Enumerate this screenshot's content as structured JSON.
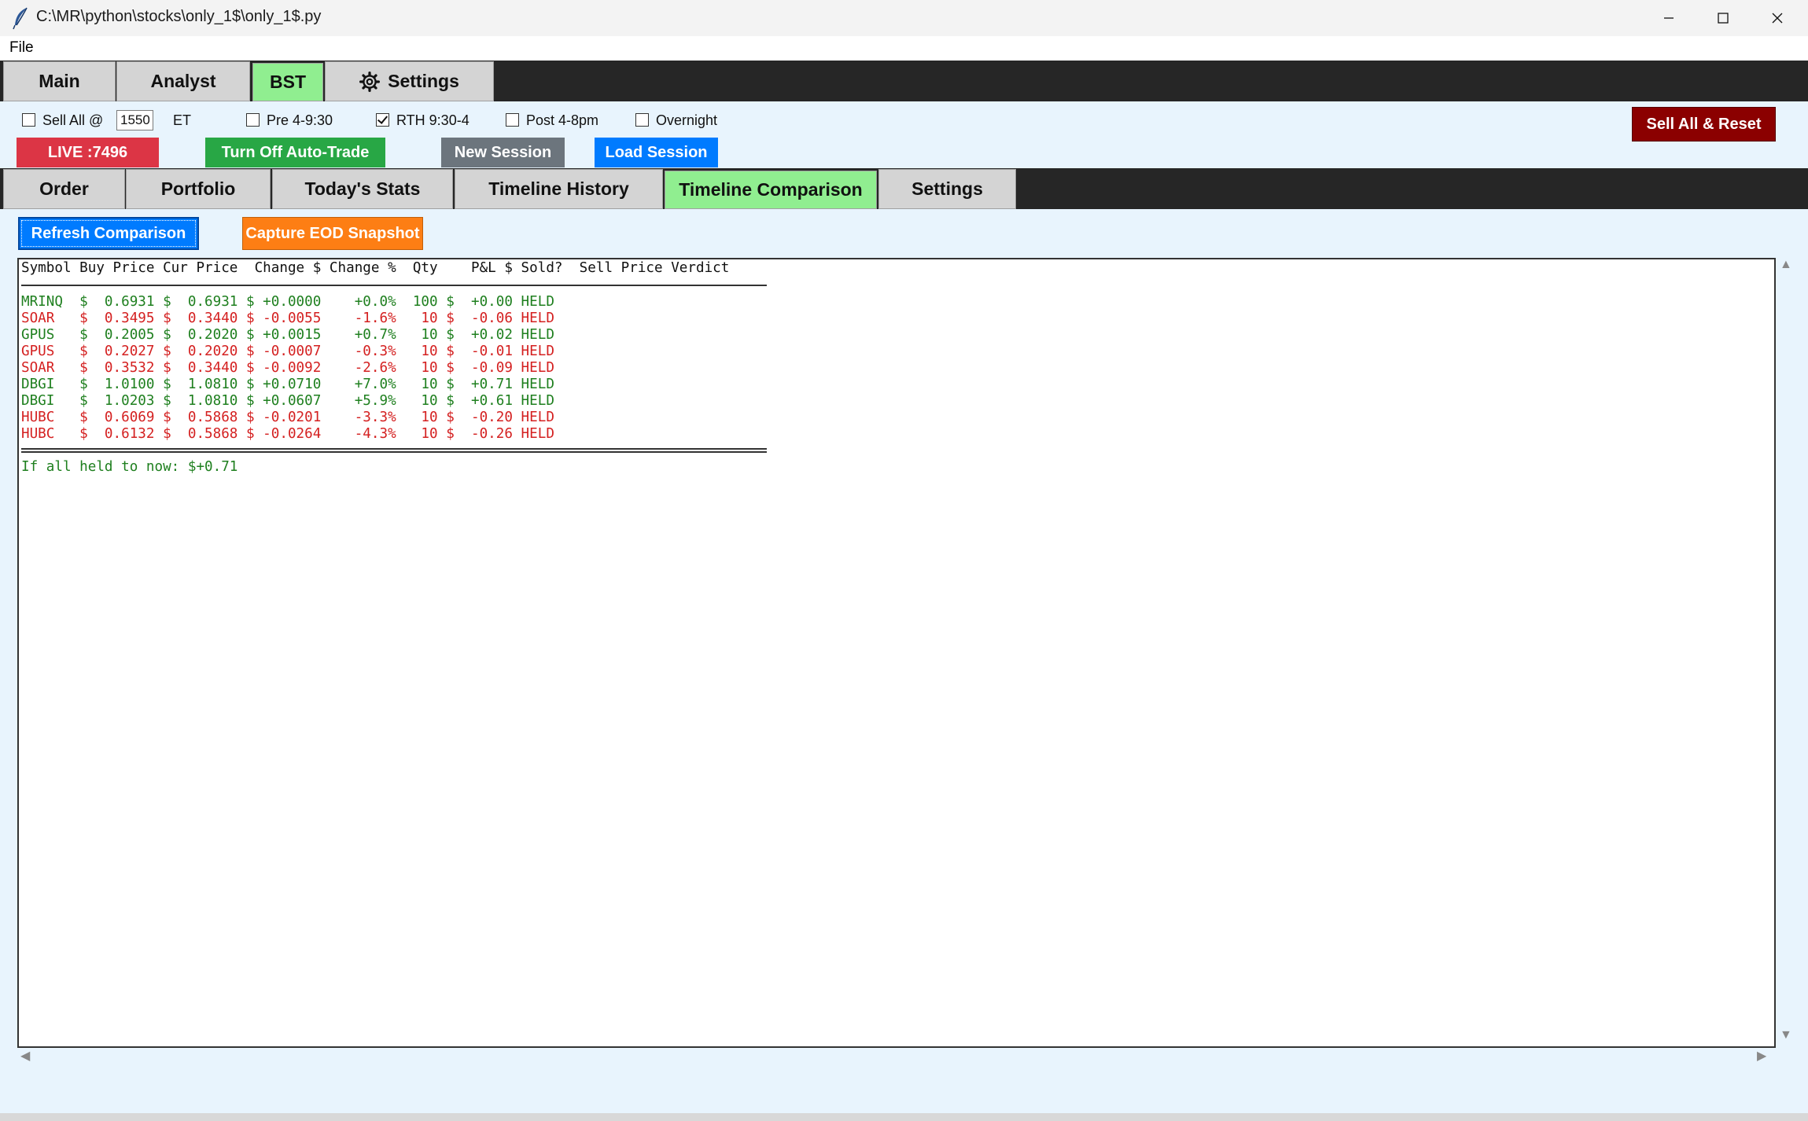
{
  "window": {
    "title": "C:\\MR\\python\\stocks\\only_1$\\only_1$.py"
  },
  "menu": {
    "file": "File"
  },
  "top_tabs": [
    {
      "label": "Main",
      "selected": false
    },
    {
      "label": "Analyst",
      "selected": false
    },
    {
      "label": "BST",
      "selected": true
    },
    {
      "label": "Settings",
      "selected": false,
      "icon": "gear-icon"
    }
  ],
  "controls": {
    "sell_all_label": "Sell All @",
    "sell_all_checked": false,
    "sell_all_time": "1550",
    "et_label": "ET",
    "pre_label": "Pre 4-9:30",
    "pre_checked": false,
    "rth_label": "RTH 9:30-4",
    "rth_checked": true,
    "post_label": "Post 4-8pm",
    "post_checked": false,
    "overnight_label": "Overnight",
    "overnight_checked": false,
    "live_label": "LIVE :7496",
    "auto_trade_label": "Turn Off Auto-Trade",
    "new_session_label": "New Session",
    "load_session_label": "Load Session",
    "sell_reset_label": "Sell All & Reset",
    "colors": {
      "live": "#dc3545",
      "auto_trade": "#28a745",
      "new_session": "#6c757d",
      "load_session": "#007bff",
      "sell_reset": "#8b0000",
      "refresh": "#007bff",
      "capture": "#fd7e14",
      "selected_tab": "#90ee90"
    }
  },
  "inner_tabs": [
    {
      "label": "Order",
      "selected": false
    },
    {
      "label": "Portfolio",
      "selected": false
    },
    {
      "label": "Today's Stats",
      "selected": false
    },
    {
      "label": "Timeline History",
      "selected": false
    },
    {
      "label": "Timeline Comparison",
      "selected": true
    },
    {
      "label": "Settings",
      "selected": false
    }
  ],
  "actions": {
    "refresh_label": "Refresh Comparison",
    "capture_label": "Capture EOD Snapshot"
  },
  "table": {
    "header": "Symbol Buy Price Cur Price  Change $ Change %  Qty    P&L $ Sold?  Sell Price Verdict",
    "rows": [
      {
        "text": "MRINQ  $  0.6931 $  0.6931 $ +0.0000    +0.0%  100 $  +0.00 HELD",
        "color": "green"
      },
      {
        "text": "SOAR   $  0.3495 $  0.3440 $ -0.0055    -1.6%   10 $  -0.06 HELD",
        "color": "red"
      },
      {
        "text": "GPUS   $  0.2005 $  0.2020 $ +0.0015    +0.7%   10 $  +0.02 HELD",
        "color": "green"
      },
      {
        "text": "GPUS   $  0.2027 $  0.2020 $ -0.0007    -0.3%   10 $  -0.01 HELD",
        "color": "red"
      },
      {
        "text": "SOAR   $  0.3532 $  0.3440 $ -0.0092    -2.6%   10 $  -0.09 HELD",
        "color": "red"
      },
      {
        "text": "DBGI   $  1.0100 $  1.0810 $ +0.0710    +7.0%   10 $  +0.71 HELD",
        "color": "green"
      },
      {
        "text": "DBGI   $  1.0203 $  1.0810 $ +0.0607    +5.9%   10 $  +0.61 HELD",
        "color": "green"
      },
      {
        "text": "HUBC   $  0.6069 $  0.5868 $ -0.0201    -3.3%   10 $  -0.20 HELD",
        "color": "red"
      },
      {
        "text": "HUBC   $  0.6132 $  0.5868 $ -0.0264    -4.3%   10 $  -0.26 HELD",
        "color": "red"
      }
    ],
    "summary": "If all held to now: $+0.71"
  }
}
